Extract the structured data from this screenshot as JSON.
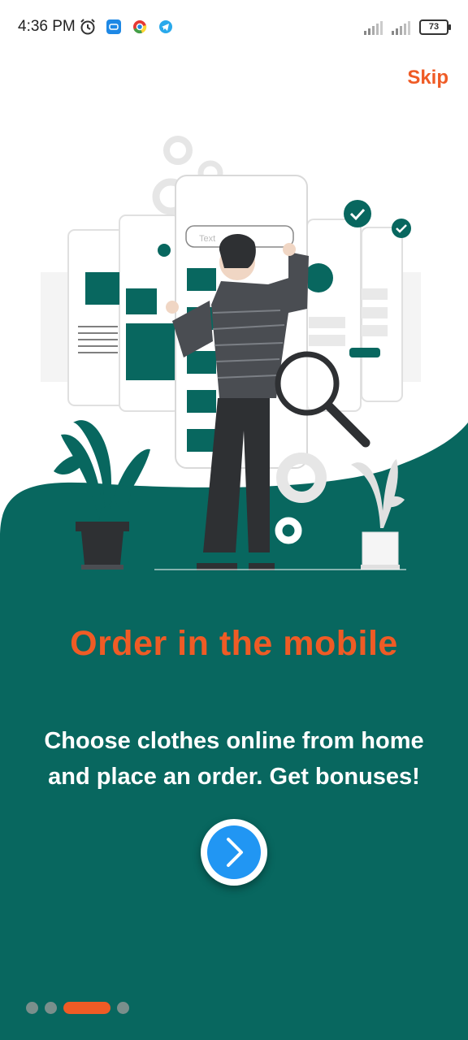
{
  "status_bar": {
    "time": "4:36 PM",
    "icons_left": [
      "alarm-icon",
      "app-notification-icon",
      "chrome-icon",
      "telegram-icon"
    ],
    "icons_right": [
      "signal-icon",
      "signal-icon"
    ],
    "battery": "73"
  },
  "header": {
    "skip_label": "Skip"
  },
  "onboarding": {
    "title": "Order in the mobile",
    "subtitle": "Choose clothes online from home and place an order. Get bonuses!",
    "illustration_search_placeholder": "Text",
    "current_page": 3,
    "total_pages": 4
  },
  "colors": {
    "accent": "#ef5b25",
    "panel": "#08675f",
    "button": "#2196f3",
    "dot_inactive": "#7a8f8c"
  }
}
